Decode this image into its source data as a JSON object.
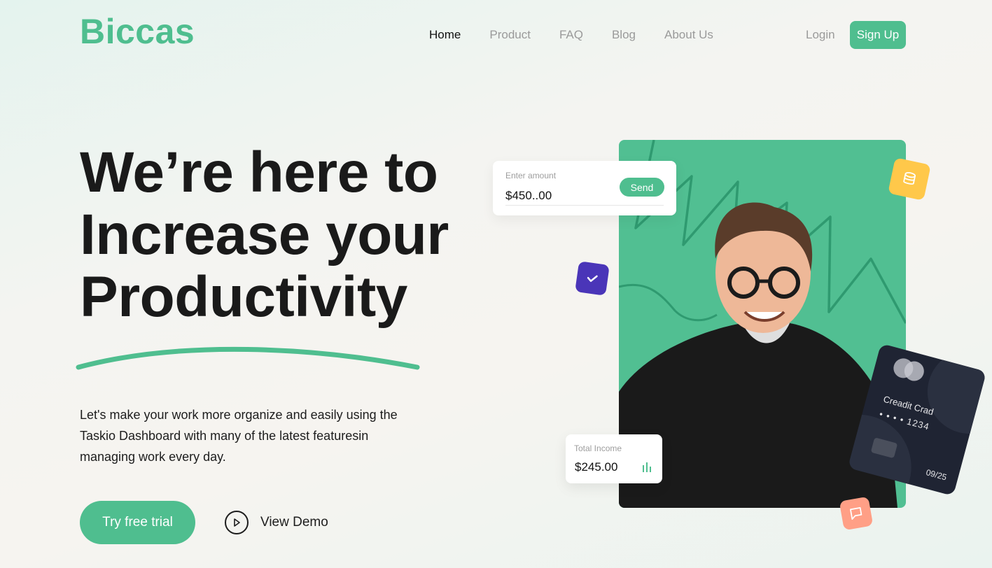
{
  "header": {
    "logo": "Biccas",
    "nav": [
      {
        "label": "Home",
        "active": true
      },
      {
        "label": "Product",
        "active": false
      },
      {
        "label": "FAQ",
        "active": false
      },
      {
        "label": "Blog",
        "active": false
      },
      {
        "label": "About Us",
        "active": false
      }
    ],
    "login_label": "Login",
    "signup_label": "Sign Up"
  },
  "hero": {
    "headline": [
      "We’re here to",
      "Increase your",
      "Productivity"
    ],
    "subtext": "Let's make your work more organize and easily using the Taskio Dashboard with many of the latest featuresin managing work every day.",
    "trial_label": "Try free trial",
    "demo_label": "View Demo"
  },
  "amount_card": {
    "label": "Enter amount",
    "value": "$450..00",
    "send_label": "Send"
  },
  "income_card": {
    "label": "Total Income",
    "value": "$245.00"
  },
  "credit_card": {
    "name": "Creadit Crad",
    "number": "• • • •  1234",
    "expiry": "09/25"
  },
  "badges": {
    "check_icon": "check-icon",
    "coin_icon": "coins-stack-icon",
    "chat_icon": "chat-bubble-icon"
  },
  "colors": {
    "accent": "#4fbe8f",
    "purple_badge": "#4a35b8",
    "yellow_badge": "#ffc84a",
    "coral_badge": "#ff9f86",
    "card_dark": "#1f2433"
  }
}
